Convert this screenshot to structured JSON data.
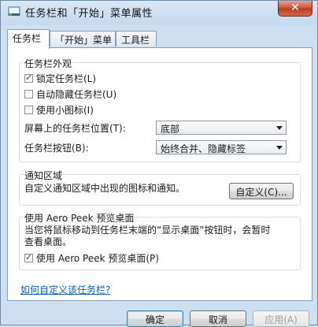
{
  "window": {
    "title": "任务栏和「开始」菜单属性",
    "close_glyph": "✕"
  },
  "tabs": [
    {
      "label": "任务栏",
      "active": true
    },
    {
      "label": "「开始」菜单",
      "active": false
    },
    {
      "label": "工具栏",
      "active": false
    }
  ],
  "appearance": {
    "group_label": "任务栏外观",
    "lock_label": "锁定任务栏(L)",
    "lock_checked": true,
    "autohide_label": "自动隐藏任务栏(U)",
    "autohide_checked": false,
    "small_icons_label": "使用小图标(I)",
    "small_icons_checked": false,
    "location_label": "屏幕上的任务栏位置(T):",
    "location_value": "底部",
    "buttons_label": "任务栏按钮(B):",
    "buttons_value": "始终合并、隐藏标签"
  },
  "notification": {
    "group_label": "通知区域",
    "description": "自定义通知区域中出现的图标和通知。",
    "customize_button": "自定义(C)..."
  },
  "peek": {
    "group_label": "使用 Aero Peek 预览桌面",
    "description_line1": "当您将鼠标移动到任务栏末端的“显示桌面”按钮时，会暂时",
    "description_line2": "查看桌面。",
    "checkbox_label": "使用 Aero Peek 预览桌面(P)",
    "checkbox_checked": true
  },
  "help_link": "如何自定义该任务栏?",
  "footer": {
    "ok": "确定",
    "cancel": "取消",
    "apply": "应用(A)"
  },
  "colors": {
    "accent": "#3c7fb1",
    "link": "#0b5fb8",
    "close": "#c75238"
  }
}
